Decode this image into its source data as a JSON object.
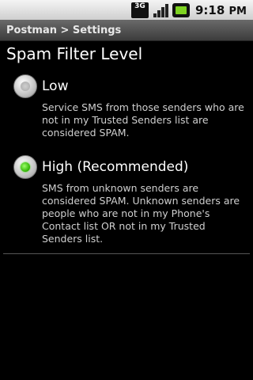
{
  "status_bar": {
    "network": "3G",
    "time": "9:18",
    "time_suffix": "PM"
  },
  "title_bar": {
    "title": "Postman > Settings"
  },
  "page": {
    "heading": "Spam Filter Level"
  },
  "options": [
    {
      "label": "Low",
      "description": "Service SMS from those senders who are not in my Trusted Senders list are considered SPAM.",
      "selected": false
    },
    {
      "label": "High (Recommended)",
      "description": "SMS from unknown senders are considered SPAM. Unknown senders are people who are not in my Phone's Contact list OR not in my Trusted Senders list.",
      "selected": true
    }
  ],
  "colors": {
    "selected_radio": "#2db100",
    "background": "#000000"
  }
}
